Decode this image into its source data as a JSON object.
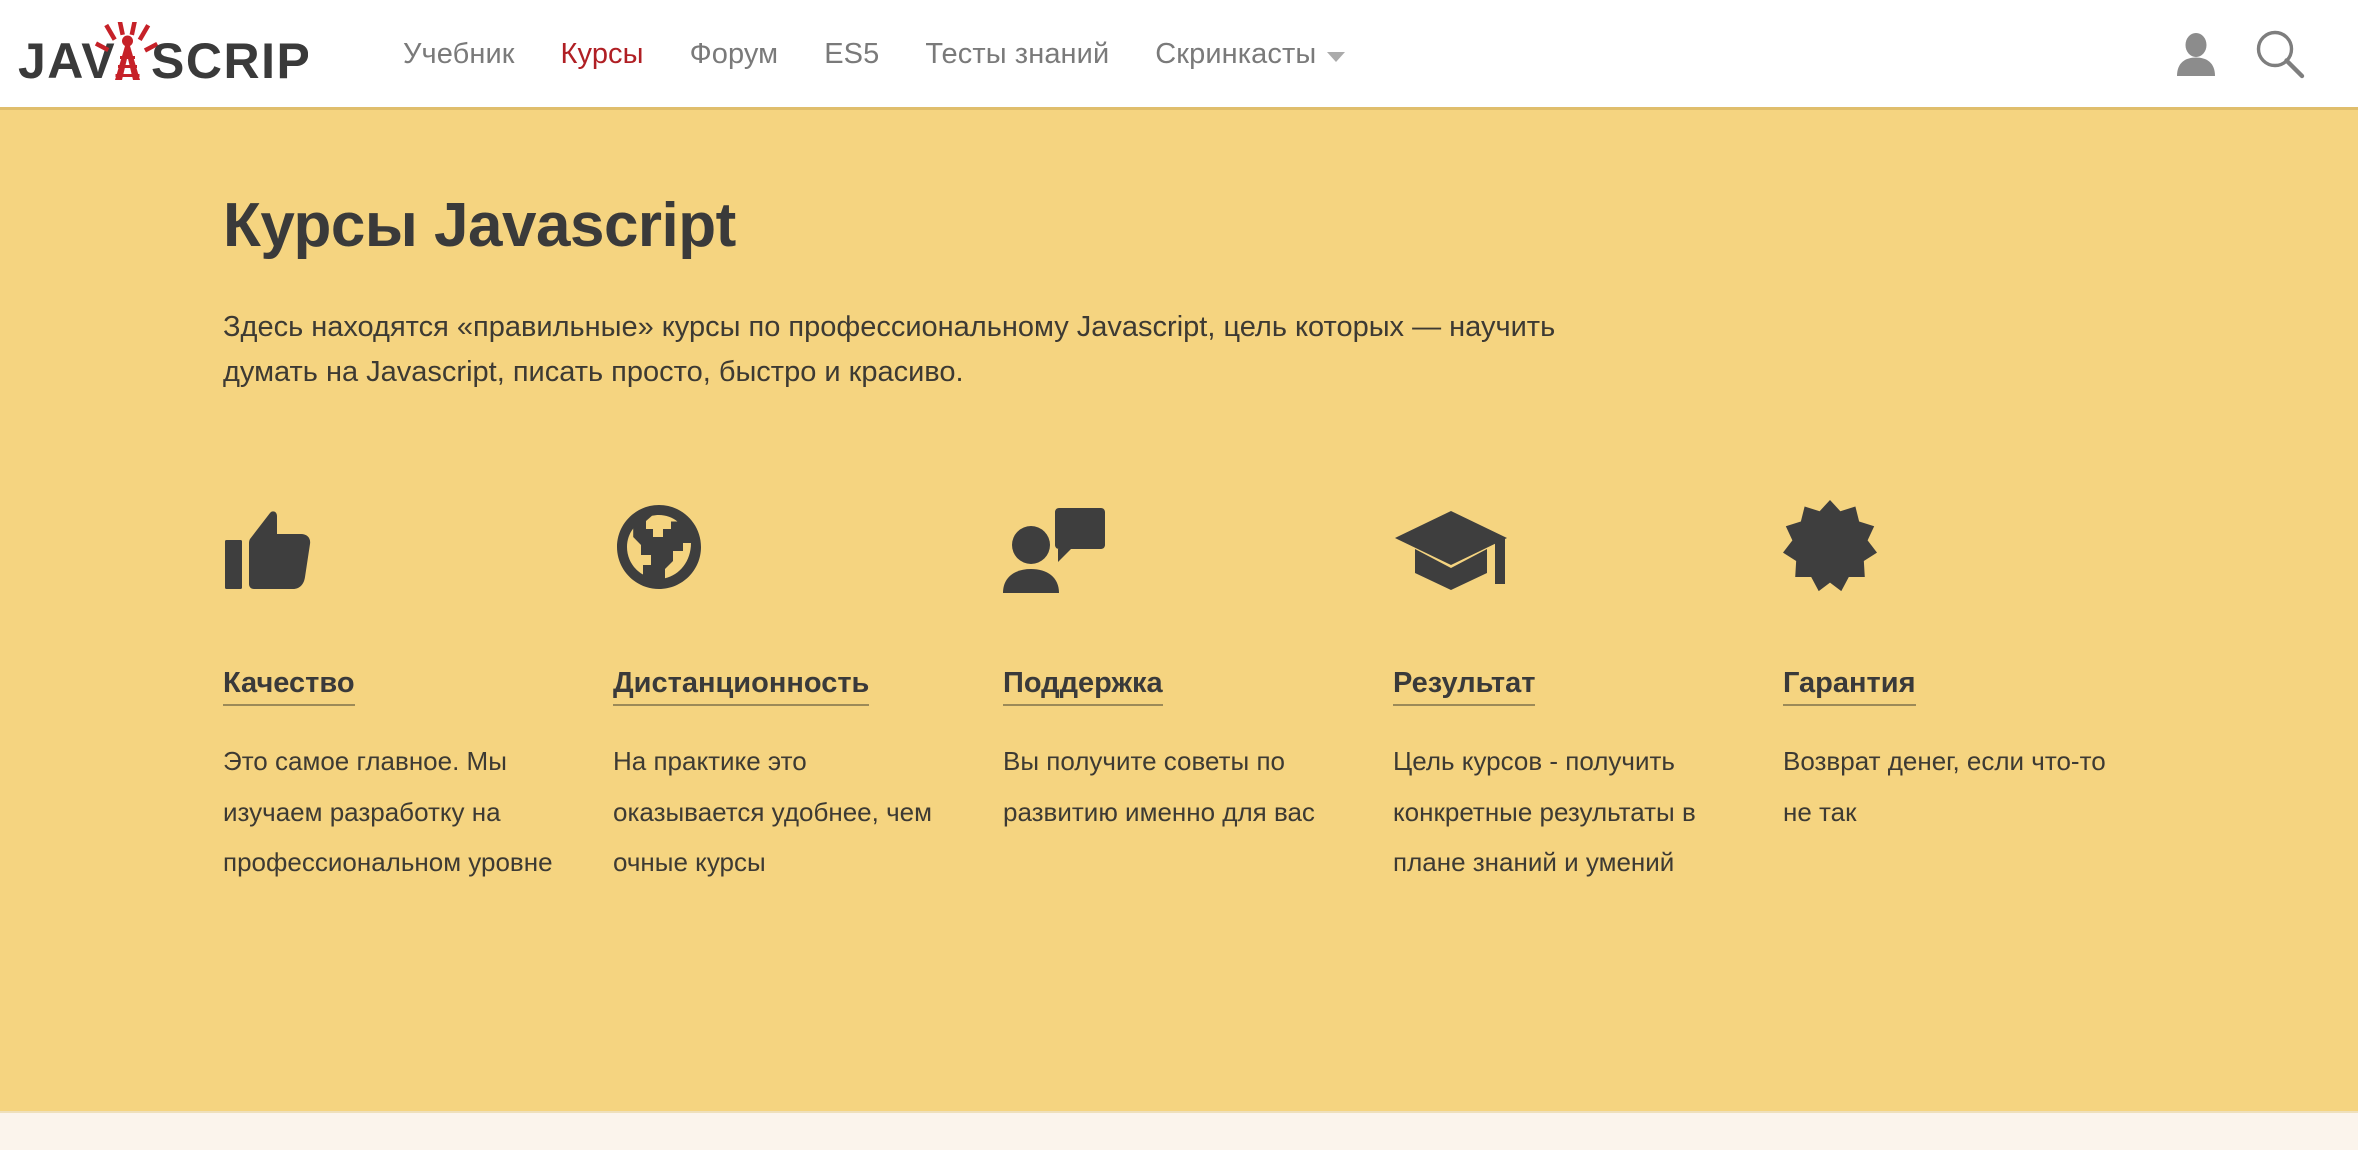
{
  "header": {
    "logo": {
      "text_before": "JAV",
      "text_after": "SCRIPT.RU",
      "alt": "javascript.ru",
      "icon": "radio-tower-icon",
      "tower_color": "#C62128",
      "text_color": "#3A3A3A"
    },
    "nav": [
      {
        "label": "Учебник",
        "active": false,
        "caret": false
      },
      {
        "label": "Курсы",
        "active": true,
        "caret": false
      },
      {
        "label": "Форум",
        "active": false,
        "caret": false
      },
      {
        "label": "ES5",
        "active": false,
        "caret": false
      },
      {
        "label": "Тесты знаний",
        "active": false,
        "caret": false
      },
      {
        "label": "Скринкасты",
        "active": false,
        "caret": true
      }
    ],
    "actions": [
      {
        "icon": "user-account-icon"
      },
      {
        "icon": "search-icon"
      }
    ]
  },
  "hero": {
    "title": "Курсы Javascript",
    "lead": "Здесь находятся «правильные» курсы по профессиональному Javascript, цель которых — научить думать на Javascript, писать просто, быстро и красиво.",
    "background_color": "#F5D480",
    "features": [
      {
        "icon": "thumbs-up-icon",
        "title": "Качество",
        "text": "Это самое главное. Мы изучаем разработку на профессиональном уровне"
      },
      {
        "icon": "globe-icon",
        "title": "Дистанционность",
        "text": "На практике это оказывается удобнее, чем очные курсы"
      },
      {
        "icon": "support-chat-icon",
        "title": "Поддержка",
        "text": "Вы получите советы по развитию именно для вас"
      },
      {
        "icon": "graduation-cap-icon",
        "title": "Результат",
        "text": "Цель курсов - получить конкретные результаты в плане знаний и умений"
      },
      {
        "icon": "award-seal-icon",
        "title": "Гарантия",
        "text": "Возврат денег, если что-то не так"
      }
    ]
  },
  "colors": {
    "accent_red": "#B01F24",
    "hero_yellow": "#F5D480",
    "dark_text": "#3A3A3A",
    "muted_nav": "#7A7A7A",
    "page_bg": "#FBF4EC"
  }
}
